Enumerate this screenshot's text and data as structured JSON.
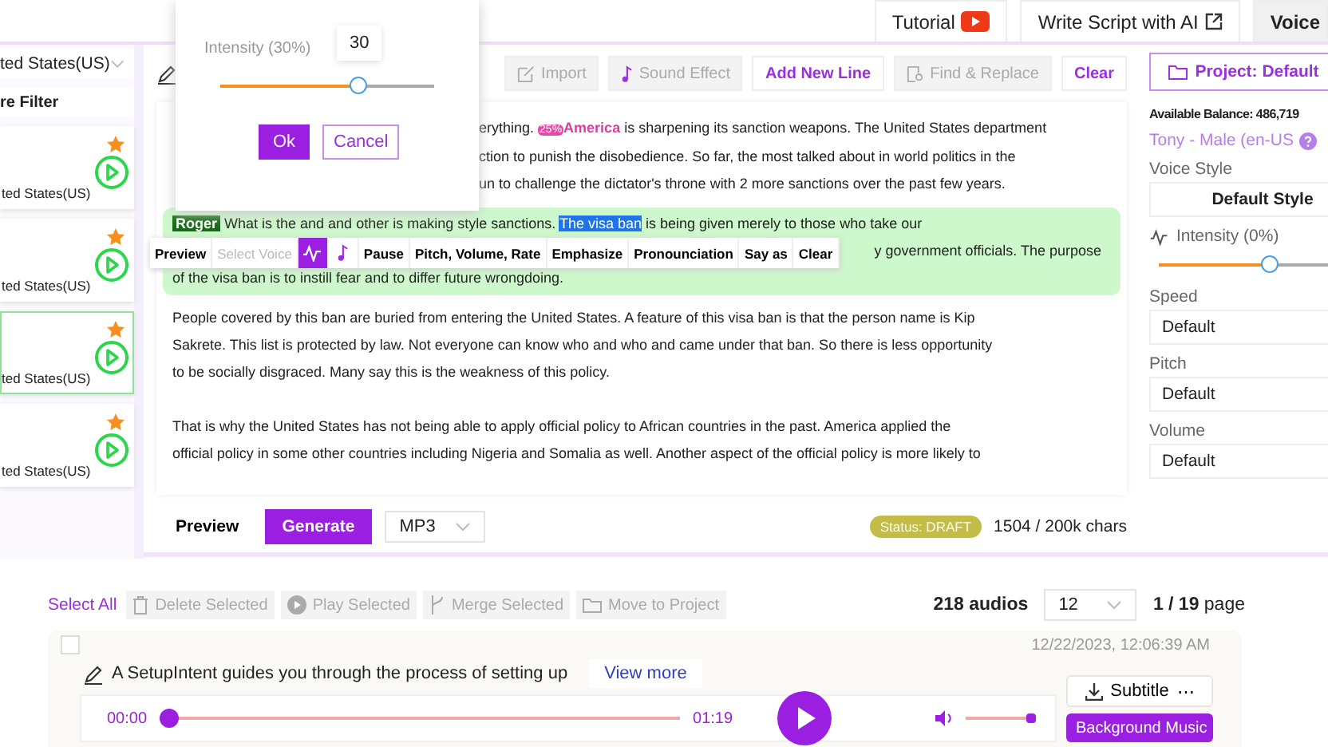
{
  "top_tabs": [
    {
      "kind": "tutorial",
      "label": "Tutorial",
      "selected": false
    },
    {
      "kind": "external",
      "label": "Write Script with AI",
      "selected": false
    },
    {
      "kind": "plain",
      "label": "Voice",
      "selected": true
    }
  ],
  "sidebar": {
    "language": "ted States(US)",
    "filter": "re Filter",
    "voices": [
      {
        "label": "ted States(US)",
        "starred": true,
        "selected": false
      },
      {
        "label": "ted States(US)",
        "starred": true,
        "selected": false
      },
      {
        "label": "ted States(US)",
        "starred": true,
        "selected": true
      },
      {
        "label": "ted States(US)",
        "starred": true,
        "selected": false
      }
    ]
  },
  "toolbar": [
    {
      "kind": "import",
      "label": "Import",
      "disabled": true
    },
    {
      "kind": "sound",
      "label": "Sound Effect",
      "disabled": true
    },
    {
      "kind": "add",
      "label": "Add New Line",
      "disabled": false
    },
    {
      "kind": "find",
      "label": "Find & Replace",
      "disabled": true
    },
    {
      "kind": "clear",
      "label": "Clear",
      "disabled": false
    }
  ],
  "paragraphs": [
    {
      "kind": "partial",
      "lines": [
        [
          {
            "kind": "text",
            "text": "erything. "
          },
          {
            "kind": "badge",
            "text": "25%"
          },
          {
            "kind": "emphasis",
            "text": "America"
          },
          {
            "kind": "text",
            "text": " is sharpening its sanction weapons. The United States department"
          }
        ],
        [
          {
            "kind": "text",
            "text": "ction to punish the disobedience. So far, the most talked about in world politics in the"
          }
        ],
        [
          {
            "kind": "text",
            "text": "un to challenge the dictator's throne with 2 more sanctions over the past few years."
          }
        ]
      ]
    },
    {
      "kind": "block",
      "lines": [
        [
          {
            "kind": "tag",
            "text": "Roger"
          },
          {
            "kind": "text",
            "text": " What is the and and other is making style sanctions. "
          },
          {
            "kind": "selected",
            "text": "The visa ban"
          },
          {
            "kind": "text",
            "text": " is being given merely to those who take our"
          }
        ],
        [
          {
            "kind": "text",
            "text": "y government officials. The purpose"
          }
        ],
        [
          {
            "kind": "text",
            "text": "of the visa ban is to instill fear and to differ future wrongdoing."
          }
        ]
      ]
    },
    {
      "kind": "plain",
      "lines": [
        [
          {
            "kind": "text",
            "text": "People covered by this ban are buried from entering the United States. A feature of this visa ban is that the person name is Kip"
          }
        ],
        [
          {
            "kind": "text",
            "text": "Sakrete. This list is protected by law. Not everyone can know who and who and came under that ban. So there is less opportunity"
          }
        ],
        [
          {
            "kind": "text",
            "text": "to be socially disgraced. Many say this is the weakness of this policy."
          }
        ]
      ]
    },
    {
      "kind": "plain",
      "lines": [
        [
          {
            "kind": "text",
            "text": "That is why the United States has not being able to apply official policy to African countries in the past. America applied the"
          }
        ],
        [
          {
            "kind": "text",
            "text": "official policy in some other countries including Nigeria and Somalia as well. Another aspect of the official policy is more likely to"
          }
        ]
      ]
    }
  ],
  "popup": {
    "label": "Intensity (30%)",
    "tooltip": "30",
    "level": 0.65,
    "ok": "Ok",
    "cancel": "Cancel"
  },
  "inline_toolbar": [
    {
      "kind": "text",
      "label": "Preview",
      "disabled": false
    },
    {
      "kind": "text",
      "label": "Select Voice",
      "disabled": true
    },
    {
      "kind": "wave",
      "selected": true
    },
    {
      "kind": "note",
      "selected": false
    },
    {
      "kind": "text",
      "label": "Pause",
      "disabled": false
    },
    {
      "kind": "text",
      "label": "Pitch, Volume, Rate",
      "disabled": false
    },
    {
      "kind": "text",
      "label": "Emphasize",
      "disabled": false
    },
    {
      "kind": "text",
      "label": "Pronounciation",
      "disabled": false
    },
    {
      "kind": "text",
      "label": "Say as",
      "disabled": false
    },
    {
      "kind": "text",
      "label": "Clear",
      "disabled": false
    }
  ],
  "editor_footer": {
    "preview": "Preview",
    "generate": "Generate",
    "format": "MP3",
    "status": "Status: DRAFT",
    "chars": "1504 / 200k chars"
  },
  "right_panel": {
    "project": "Project: Default",
    "balance": "Available Balance: 486,719",
    "voice": "Tony - Male (en-US",
    "style_label": "Voice Style",
    "style": "Default Style",
    "intensity": {
      "label": "Intensity (0%)",
      "level": 0.5
    },
    "settings": [
      {
        "label": "Speed",
        "value": "Default"
      },
      {
        "label": "Pitch",
        "value": "Default"
      },
      {
        "label": "Volume",
        "value": "Default"
      }
    ]
  },
  "list_toolbar": {
    "select_all": "Select All",
    "actions": [
      {
        "kind": "delete",
        "label": "Delete Selected"
      },
      {
        "kind": "play",
        "label": "Play Selected"
      },
      {
        "kind": "merge",
        "label": "Merge Selected"
      },
      {
        "kind": "move",
        "label": "Move to Project"
      }
    ],
    "count": "218 audios",
    "page_size": "12",
    "page": "1 / 19",
    "page_word": "page"
  },
  "audio": {
    "checked": false,
    "timestamp": "12/22/2023, 12:06:39 AM",
    "text": "A SetupIntent guides you through the process of setting up",
    "more": "View more",
    "current": "00:00",
    "duration": "01:19",
    "progress": {
      "level": 0
    },
    "volume": {
      "level": 1
    },
    "subtitle": "Subtitle",
    "more_icon": "⋯",
    "music": "Background Music"
  }
}
